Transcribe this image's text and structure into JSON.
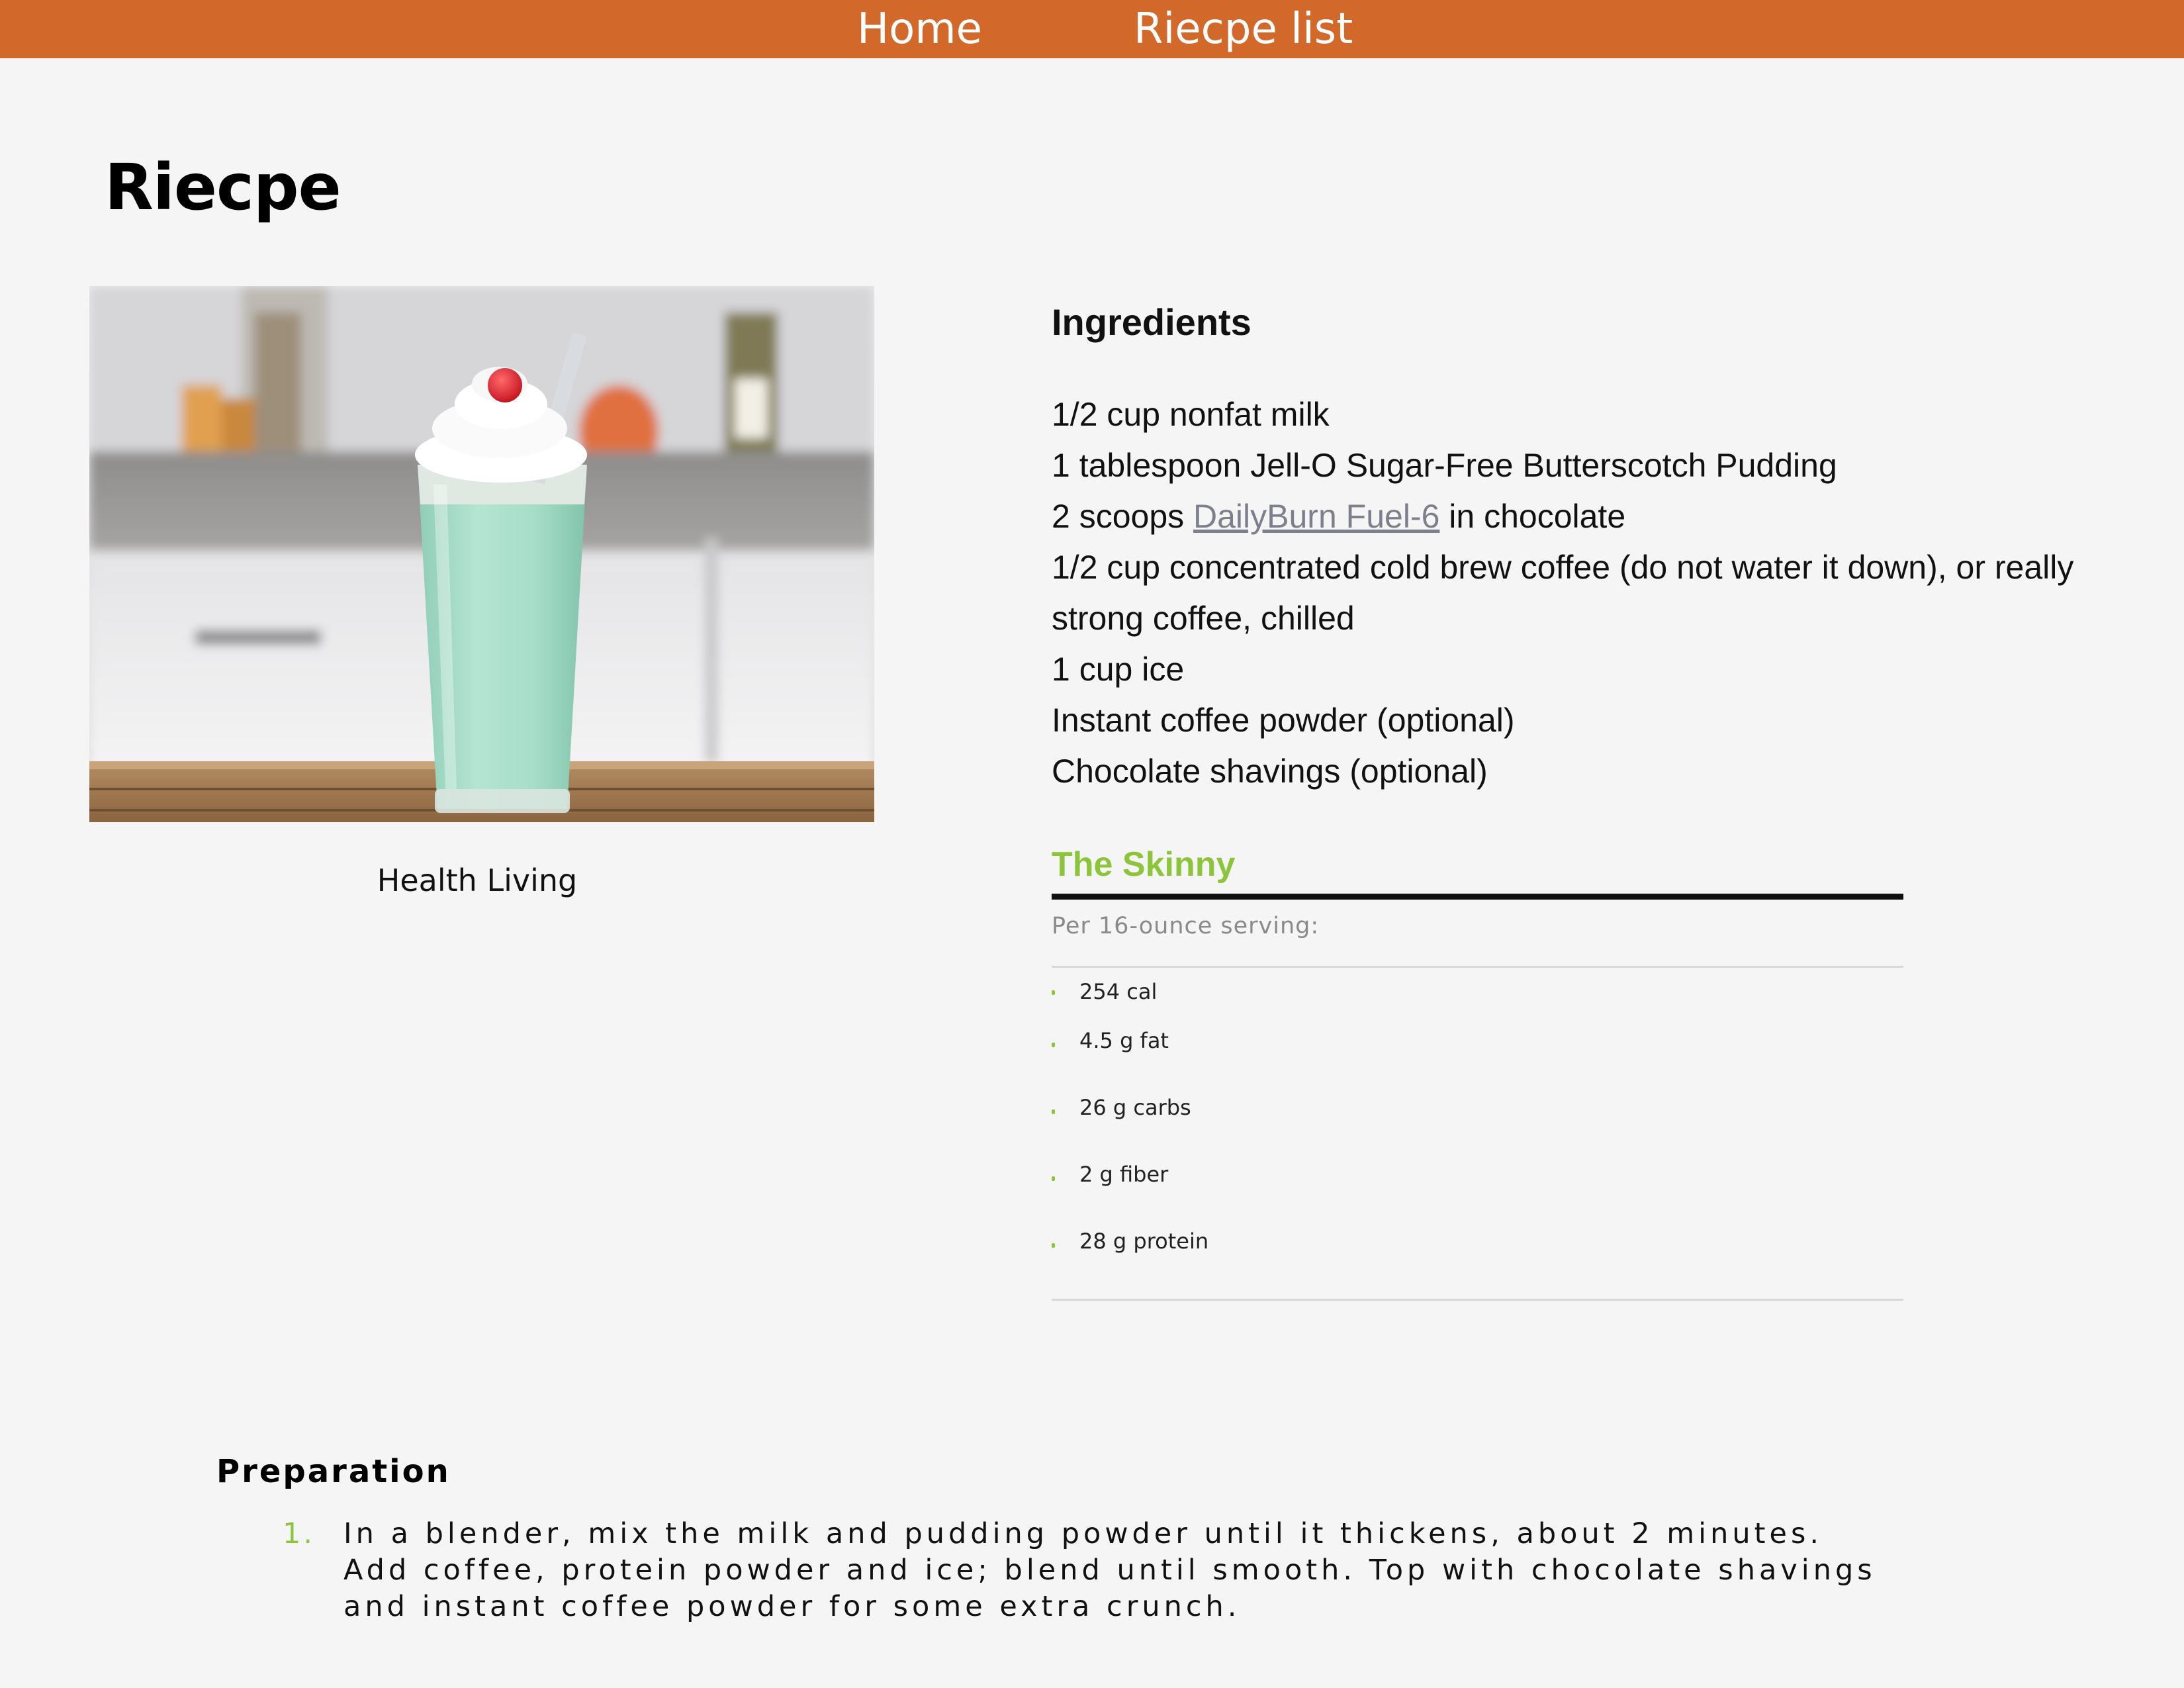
{
  "nav": {
    "home": "Home",
    "recipe_list": "Riecpe list"
  },
  "page_title": "Riecpe",
  "image": {
    "alt": "Mint milkshake with whipped cream and a cherry",
    "caption": "Health Living"
  },
  "ingredients": {
    "heading": "Ingredients",
    "items": [
      "1/2 cup nonfat milk",
      "1 tablespoon Jell-O Sugar-Free Butterscotch Pudding",
      {
        "before": "2 scoops ",
        "link": "DailyBurn Fuel-6",
        "after": " in chocolate"
      },
      "1/2 cup concentrated cold brew coffee (do not water it down), or really strong coffee, chilled",
      "1 cup ice",
      "Instant coffee powder (optional)",
      "Chocolate shavings (optional)"
    ]
  },
  "skinny": {
    "title": "The Skinny",
    "subtitle": "Per 16-ounce serving:",
    "items": [
      "254 cal",
      "4.5 g fat",
      "26 g carbs",
      "2 g fiber",
      "28 g protein"
    ]
  },
  "preparation": {
    "heading": "Preparation",
    "steps": [
      "In a blender, mix the milk and pudding powder until it thickens, about 2 minutes. Add coffee, protein powder and ice; blend until smooth. Top with chocolate shavings and instant coffee powder for some extra crunch."
    ]
  },
  "colors": {
    "nav_bar": "#d2692b",
    "skinny_accent": "#8cc43a",
    "link": "#7d7f8c",
    "page_background": "#f5f5f5"
  }
}
